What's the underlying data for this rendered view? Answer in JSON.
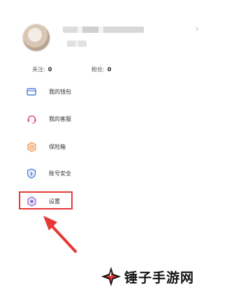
{
  "profile": {
    "chevron": "›"
  },
  "stats": {
    "follow_label": "关注:",
    "follow_count": "0",
    "fans_label": "粉丝:",
    "fans_count": "0"
  },
  "menu": {
    "items": [
      {
        "label": "我的钱包",
        "icon": "wallet-icon"
      },
      {
        "label": "我的客服",
        "icon": "headset-icon"
      },
      {
        "label": "保险箱",
        "icon": "safe-icon"
      },
      {
        "label": "账号安全",
        "icon": "shield-icon"
      },
      {
        "label": "设置",
        "icon": "settings-icon"
      }
    ]
  },
  "watermark": {
    "brand": "锤子手游网"
  },
  "colors": {
    "annotation": "#e53935",
    "wallet": "#4a7dd6",
    "service": "#e0527a",
    "safe": "#e8914a",
    "shield": "#4a7dd6",
    "settings": "#8a63c9"
  }
}
